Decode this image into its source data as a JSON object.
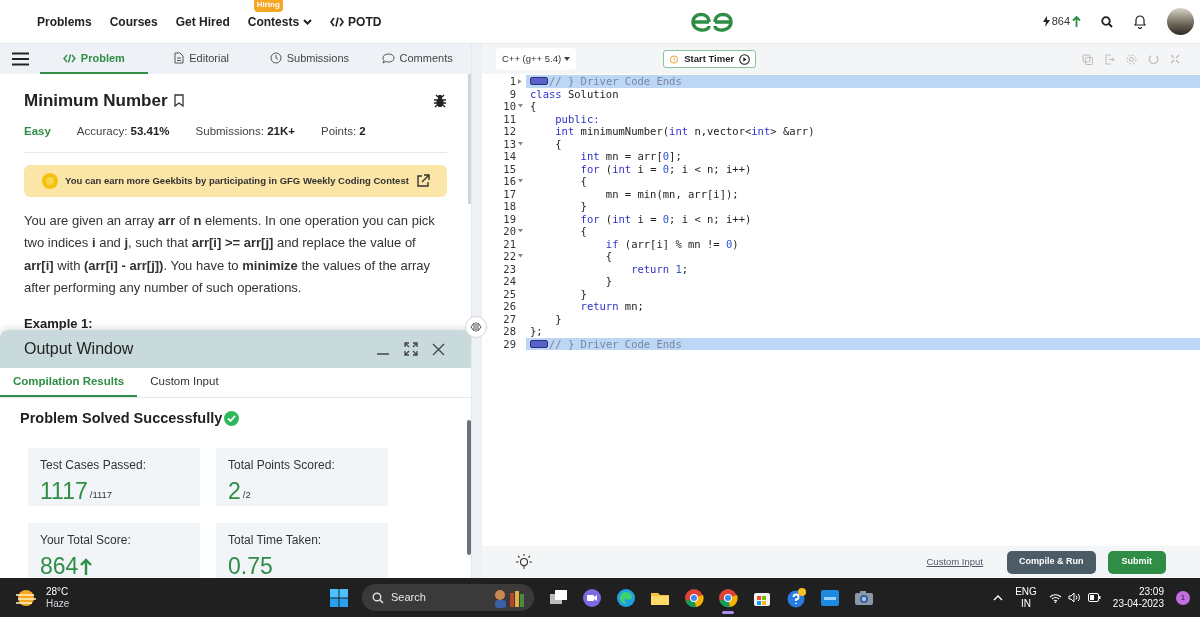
{
  "nav": {
    "items": [
      {
        "label": "Problems",
        "kind": "plain"
      },
      {
        "label": "Courses",
        "kind": "plain"
      },
      {
        "label": "Get Hired",
        "kind": "plain"
      },
      {
        "label": "Contests",
        "kind": "dropdown",
        "badge": "Hiring"
      },
      {
        "label": "POTD",
        "kind": "code"
      }
    ],
    "geekbits": "864"
  },
  "problem_tabs": [
    {
      "label": "Problem",
      "kind": "code",
      "selected": true
    },
    {
      "label": "Editorial",
      "kind": "document",
      "selected": false
    },
    {
      "label": "Submissions",
      "kind": "clock",
      "selected": false
    },
    {
      "label": "Comments",
      "kind": "comment",
      "selected": false
    }
  ],
  "problem": {
    "title": "Minimum Number",
    "difficulty": "Easy",
    "meta": [
      {
        "label": "Accuracy:",
        "value": "53.41%"
      },
      {
        "label": "Submissions:",
        "value": "21K+"
      },
      {
        "label": "Points:",
        "value": "2"
      }
    ],
    "banner": "You can earn more Geekbits by participating in GFG Weekly Coding Contest",
    "description": "You are given an array **arr** of **n** elements. In one operation you can pick two indices **i** and **j**, such that **arr[i] >= arr[j]** and replace the value of **arr[i]** with **(arr[i] - arr[j])**. You have to **minimize** the values of the array after performing any number of such operations.",
    "example_heading": "Example 1:"
  },
  "output_window": {
    "title": "Output Window",
    "tabs": [
      {
        "label": "Compilation Results",
        "selected": true
      },
      {
        "label": "Custom Input",
        "selected": false
      }
    ],
    "status": "Problem Solved Successfully",
    "cards": [
      {
        "label": "Test Cases Passed:",
        "value": "1117",
        "total": "/1117",
        "up": false
      },
      {
        "label": "Total Points Scored:",
        "value": "2",
        "total": "/2",
        "up": false
      },
      {
        "label": "Your Total Score:",
        "value": "864",
        "up": true
      },
      {
        "label": "Total Time Taken:",
        "value": "0.75",
        "up": false
      }
    ]
  },
  "editor": {
    "language": "C++ (g++ 5.4)",
    "timer_button": "Start Timer",
    "lines": [
      {
        "number": "1",
        "foldable": true,
        "collapsed": true,
        "highlighted": true,
        "segments": [
          {
            "kind": "comment",
            "text": "// } Driver Code Ends"
          }
        ]
      },
      {
        "number": "9",
        "foldable": false,
        "collapsed": false,
        "highlighted": false,
        "segments": [
          {
            "kind": "keyword",
            "text": "class"
          },
          {
            "kind": "plain",
            "text": " Solution"
          }
        ]
      },
      {
        "number": "10",
        "foldable": true,
        "collapsed": false,
        "highlighted": false,
        "segments": [
          {
            "kind": "plain",
            "text": "{"
          }
        ]
      },
      {
        "number": "11",
        "foldable": false,
        "collapsed": false,
        "highlighted": false,
        "segments": [
          {
            "kind": "keyword",
            "text": "    public:"
          }
        ]
      },
      {
        "number": "12",
        "foldable": false,
        "collapsed": false,
        "highlighted": false,
        "segments": [
          {
            "kind": "keyword",
            "text": "    int"
          },
          {
            "kind": "plain",
            "text": " minimumNumber("
          },
          {
            "kind": "keyword",
            "text": "int"
          },
          {
            "kind": "plain",
            "text": " n,vector<"
          },
          {
            "kind": "keyword",
            "text": "int"
          },
          {
            "kind": "plain",
            "text": "> &arr)"
          }
        ]
      },
      {
        "number": "13",
        "foldable": true,
        "collapsed": false,
        "highlighted": false,
        "segments": [
          {
            "kind": "plain",
            "text": "    {"
          }
        ]
      },
      {
        "number": "14",
        "foldable": false,
        "collapsed": false,
        "highlighted": false,
        "segments": [
          {
            "kind": "keyword",
            "text": "        int"
          },
          {
            "kind": "plain",
            "text": " mn = arr["
          },
          {
            "kind": "number",
            "text": "0"
          },
          {
            "kind": "plain",
            "text": "];"
          }
        ]
      },
      {
        "number": "15",
        "foldable": false,
        "collapsed": false,
        "highlighted": false,
        "segments": [
          {
            "kind": "keyword",
            "text": "        for"
          },
          {
            "kind": "plain",
            "text": " ("
          },
          {
            "kind": "keyword",
            "text": "int"
          },
          {
            "kind": "plain",
            "text": " i = "
          },
          {
            "kind": "number",
            "text": "0"
          },
          {
            "kind": "plain",
            "text": "; i < n; i++)"
          }
        ]
      },
      {
        "number": "16",
        "foldable": true,
        "collapsed": false,
        "highlighted": false,
        "segments": [
          {
            "kind": "plain",
            "text": "        {"
          }
        ]
      },
      {
        "number": "17",
        "foldable": false,
        "collapsed": false,
        "highlighted": false,
        "segments": [
          {
            "kind": "plain",
            "text": "            mn = min(mn, arr[i]);"
          }
        ]
      },
      {
        "number": "18",
        "foldable": false,
        "collapsed": false,
        "highlighted": false,
        "segments": [
          {
            "kind": "plain",
            "text": "        }"
          }
        ]
      },
      {
        "number": "19",
        "foldable": false,
        "collapsed": false,
        "highlighted": false,
        "segments": [
          {
            "kind": "keyword",
            "text": "        for"
          },
          {
            "kind": "plain",
            "text": " ("
          },
          {
            "kind": "keyword",
            "text": "int"
          },
          {
            "kind": "plain",
            "text": " i = "
          },
          {
            "kind": "number",
            "text": "0"
          },
          {
            "kind": "plain",
            "text": "; i < n; i++)"
          }
        ]
      },
      {
        "number": "20",
        "foldable": true,
        "collapsed": false,
        "highlighted": false,
        "segments": [
          {
            "kind": "plain",
            "text": "        {"
          }
        ]
      },
      {
        "number": "21",
        "foldable": false,
        "collapsed": false,
        "highlighted": false,
        "segments": [
          {
            "kind": "keyword",
            "text": "            if"
          },
          {
            "kind": "plain",
            "text": " (arr[i] % mn != "
          },
          {
            "kind": "number",
            "text": "0"
          },
          {
            "kind": "plain",
            "text": ")"
          }
        ]
      },
      {
        "number": "22",
        "foldable": true,
        "collapsed": false,
        "highlighted": false,
        "segments": [
          {
            "kind": "plain",
            "text": "            {"
          }
        ]
      },
      {
        "number": "23",
        "foldable": false,
        "collapsed": false,
        "highlighted": false,
        "segments": [
          {
            "kind": "keyword",
            "text": "                return "
          },
          {
            "kind": "number",
            "text": "1"
          },
          {
            "kind": "plain",
            "text": ";"
          }
        ]
      },
      {
        "number": "24",
        "foldable": false,
        "collapsed": false,
        "highlighted": false,
        "segments": [
          {
            "kind": "plain",
            "text": "            }"
          }
        ]
      },
      {
        "number": "25",
        "foldable": false,
        "collapsed": false,
        "highlighted": false,
        "segments": [
          {
            "kind": "plain",
            "text": "        }"
          }
        ]
      },
      {
        "number": "26",
        "foldable": false,
        "collapsed": false,
        "highlighted": false,
        "segments": [
          {
            "kind": "keyword",
            "text": "        return"
          },
          {
            "kind": "plain",
            "text": " mn;"
          }
        ]
      },
      {
        "number": "27",
        "foldable": false,
        "collapsed": false,
        "highlighted": false,
        "segments": [
          {
            "kind": "plain",
            "text": "    }"
          }
        ]
      },
      {
        "number": "28",
        "foldable": false,
        "collapsed": false,
        "highlighted": false,
        "segments": [
          {
            "kind": "plain",
            "text": "};"
          }
        ]
      },
      {
        "number": "29",
        "foldable": false,
        "collapsed": true,
        "highlighted": true,
        "segments": [
          {
            "kind": "comment",
            "text": "// } Driver Code Ends"
          }
        ]
      }
    ],
    "custom_input_link": "Custom Input",
    "compile_button": "Compile & Run",
    "submit_button": "Submit"
  },
  "taskbar": {
    "temperature": "28°C",
    "condition": "Haze",
    "search": "Search",
    "apps": [
      {
        "kind": "task-view",
        "running": false
      },
      {
        "kind": "chat",
        "running": false
      },
      {
        "kind": "edge",
        "running": false
      },
      {
        "kind": "folder",
        "running": false
      },
      {
        "kind": "chrome",
        "running": false
      },
      {
        "kind": "chrome",
        "running": true
      },
      {
        "kind": "store",
        "running": false
      },
      {
        "kind": "help",
        "running": false
      },
      {
        "kind": "tile",
        "running": false
      },
      {
        "kind": "camera",
        "running": false
      }
    ],
    "language": "ENG",
    "region": "IN",
    "time": "23:09",
    "date": "23-04-2023",
    "notifications": "1"
  }
}
